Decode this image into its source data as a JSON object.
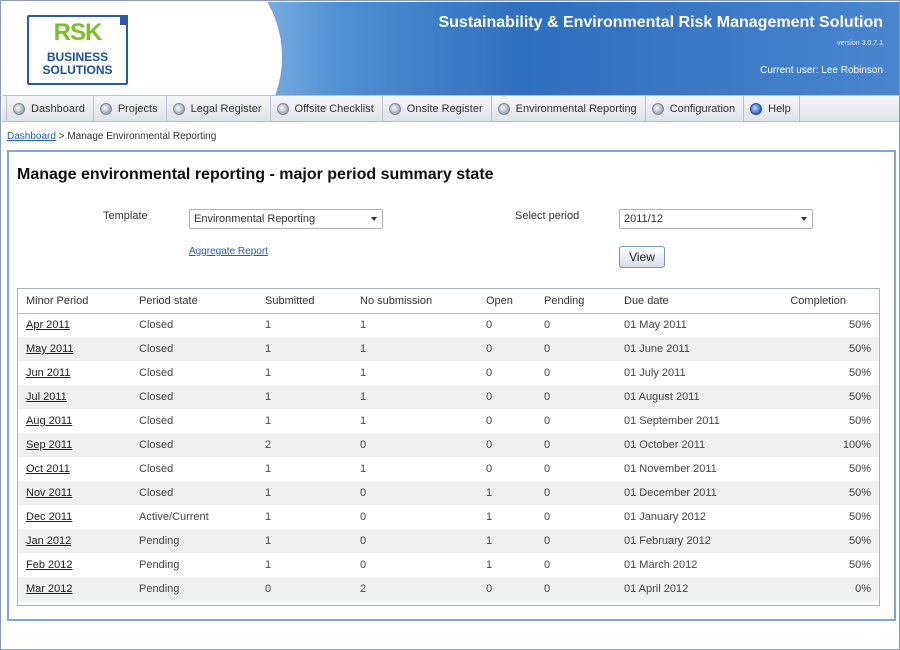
{
  "header": {
    "logo_line1": "RSK",
    "logo_line2": "BUSINESS",
    "logo_line3": "SOLUTIONS",
    "app_title": "Sustainability & Environmental Risk Management Solution",
    "version": "version 3.0.7.1",
    "current_user": "Current user: Lee Robinson"
  },
  "nav": {
    "items": [
      {
        "label": "Dashboard",
        "icon": "dashboard-icon"
      },
      {
        "label": "Projects",
        "icon": "projects-icon"
      },
      {
        "label": "Legal Register",
        "icon": "hammer-icon"
      },
      {
        "label": "Offsite Checklist",
        "icon": "checklist-icon"
      },
      {
        "label": "Onsite Register",
        "icon": "register-icon"
      },
      {
        "label": "Environmental Reporting",
        "icon": "reporting-icon"
      },
      {
        "label": "Configuration",
        "icon": "gear-icon"
      },
      {
        "label": "Help",
        "icon": "help-icon"
      }
    ]
  },
  "breadcrumb": {
    "link": "Dashboard",
    "current": " > Manage Environmental Reporting"
  },
  "main": {
    "title": "Manage environmental reporting - major period summary state",
    "template_label": "Template",
    "template_value": "Environmental Reporting",
    "period_label": "Select period",
    "period_value": "2011/12",
    "aggregate_link": "Aggregate Report",
    "view_button": "View"
  },
  "table": {
    "headers": [
      "Minor Period",
      "Period state",
      "Submitted",
      "No submission",
      "Open",
      "Pending",
      "Due date",
      "Completion"
    ],
    "rows": [
      [
        "Apr 2011",
        "Closed",
        "1",
        "1",
        "0",
        "0",
        "01 May 2011",
        "50%"
      ],
      [
        "May 2011",
        "Closed",
        "1",
        "1",
        "0",
        "0",
        "01 June 2011",
        "50%"
      ],
      [
        "Jun 2011",
        "Closed",
        "1",
        "1",
        "0",
        "0",
        "01 July 2011",
        "50%"
      ],
      [
        "Jul 2011",
        "Closed",
        "1",
        "1",
        "0",
        "0",
        "01 August 2011",
        "50%"
      ],
      [
        "Aug 2011",
        "Closed",
        "1",
        "1",
        "0",
        "0",
        "01 September 2011",
        "50%"
      ],
      [
        "Sep 2011",
        "Closed",
        "2",
        "0",
        "0",
        "0",
        "01 October 2011",
        "100%"
      ],
      [
        "Oct 2011",
        "Closed",
        "1",
        "1",
        "0",
        "0",
        "01 November 2011",
        "50%"
      ],
      [
        "Nov 2011",
        "Closed",
        "1",
        "0",
        "1",
        "0",
        "01 December 2011",
        "50%"
      ],
      [
        "Dec 2011",
        "Active/Current",
        "1",
        "0",
        "1",
        "0",
        "01 January 2012",
        "50%"
      ],
      [
        "Jan 2012",
        "Pending",
        "1",
        "0",
        "1",
        "0",
        "01 February 2012",
        "50%"
      ],
      [
        "Feb 2012",
        "Pending",
        "1",
        "0",
        "1",
        "0",
        "01 March 2012",
        "50%"
      ],
      [
        "Mar 2012",
        "Pending",
        "0",
        "2",
        "0",
        "0",
        "01 April 2012",
        "0%"
      ]
    ]
  }
}
